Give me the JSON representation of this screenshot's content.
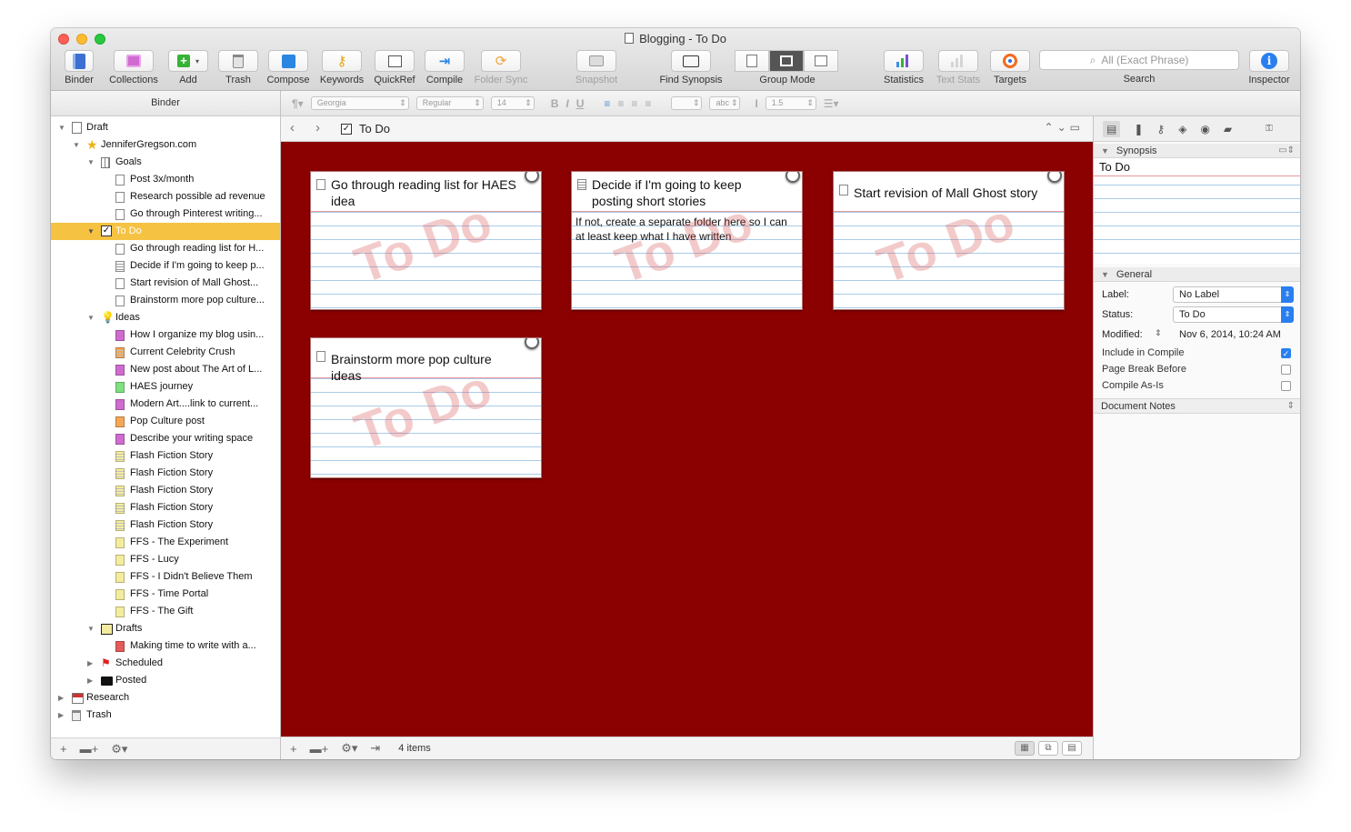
{
  "window": {
    "title": "Blogging - To Do"
  },
  "toolbar": {
    "binder": "Binder",
    "collections": "Collections",
    "add": "Add",
    "trash": "Trash",
    "compose": "Compose",
    "keywords": "Keywords",
    "quickref": "QuickRef",
    "compile": "Compile",
    "folder_sync": "Folder Sync",
    "snapshot": "Snapshot",
    "find_synopsis": "Find Synopsis",
    "group_mode": "Group Mode",
    "statistics": "Statistics",
    "text_stats": "Text Stats",
    "targets": "Targets",
    "search_placeholder": "All (Exact Phrase)",
    "search": "Search",
    "inspector": "Inspector"
  },
  "format_bar": {
    "font": "Georgia",
    "style": "Regular",
    "size": "14",
    "color_label": "abc",
    "line_spacing": "1.5"
  },
  "binder": {
    "header": "Binder",
    "items": [
      {
        "label": "Draft",
        "icon": "draft-document-icon"
      },
      {
        "label": "JenniferGregson.com",
        "icon": "star-icon"
      },
      {
        "label": "Goals",
        "icon": "grid-folder-icon"
      },
      {
        "label": "Post 3x/month",
        "icon": "page-icon"
      },
      {
        "label": "Research possible ad revenue",
        "icon": "page-icon"
      },
      {
        "label": "Go through Pinterest writing...",
        "icon": "page-icon"
      },
      {
        "label": "To Do",
        "icon": "checkbox-icon"
      },
      {
        "label": "Go through reading list for H...",
        "icon": "page-icon"
      },
      {
        "label": "Decide if I'm going to keep p...",
        "icon": "page-icon"
      },
      {
        "label": "Start revision of Mall Ghost...",
        "icon": "page-icon"
      },
      {
        "label": "Brainstorm more pop culture...",
        "icon": "page-icon"
      },
      {
        "label": "Ideas",
        "icon": "lightbulb-icon"
      },
      {
        "label": "How I organize my blog usin...",
        "icon": "page-icon"
      },
      {
        "label": "Current Celebrity Crush",
        "icon": "page-icon"
      },
      {
        "label": "New post about The Art of L...",
        "icon": "page-icon"
      },
      {
        "label": "HAES journey",
        "icon": "page-icon"
      },
      {
        "label": "Modern Art....link to current...",
        "icon": "page-icon"
      },
      {
        "label": "Pop Culture post",
        "icon": "page-icon"
      },
      {
        "label": "Describe your writing space",
        "icon": "page-icon"
      },
      {
        "label": "Flash Fiction Story",
        "icon": "page-icon"
      },
      {
        "label": "Flash Fiction Story",
        "icon": "page-icon"
      },
      {
        "label": "Flash Fiction Story",
        "icon": "page-icon"
      },
      {
        "label": "Flash Fiction Story",
        "icon": "page-icon"
      },
      {
        "label": "Flash Fiction Story",
        "icon": "page-icon"
      },
      {
        "label": "FFS - The Experiment",
        "icon": "page-icon"
      },
      {
        "label": "FFS - Lucy",
        "icon": "page-icon"
      },
      {
        "label": "FFS - I Didn't Believe Them",
        "icon": "page-icon"
      },
      {
        "label": "FFS - Time Portal",
        "icon": "page-icon"
      },
      {
        "label": "FFS - The Gift",
        "icon": "page-icon"
      },
      {
        "label": "Drafts",
        "icon": "notebook-icon"
      },
      {
        "label": "Making time to write with a...",
        "icon": "page-icon"
      },
      {
        "label": "Scheduled",
        "icon": "flag-icon"
      },
      {
        "label": "Posted",
        "icon": "monitor-icon"
      },
      {
        "label": "Research",
        "icon": "research-folder-icon"
      },
      {
        "label": "Trash",
        "icon": "trash-icon"
      }
    ]
  },
  "editor": {
    "title": "To Do",
    "item_count": "4 items",
    "cards": [
      {
        "title": "Go through reading list for HAES idea",
        "body": "",
        "stamp": "To Do"
      },
      {
        "title": "Decide if I'm going to keep posting short stories",
        "body": "If not, create a separate folder here so I can at least keep what I have written",
        "stamp": "To Do"
      },
      {
        "title": "Start revision of Mall Ghost story",
        "body": "",
        "stamp": "To Do"
      },
      {
        "title": "Brainstorm more pop culture ideas",
        "body": "",
        "stamp": "To Do"
      }
    ]
  },
  "inspector": {
    "synopsis_header": "Synopsis",
    "synopsis_text": "To Do",
    "general_header": "General",
    "label_field": "Label:",
    "label_value": "No Label",
    "status_field": "Status:",
    "status_value": "To Do",
    "modified_field": "Modified:",
    "modified_value": "Nov 6, 2014, 10:24 AM",
    "include_in_compile": "Include in Compile",
    "page_break_before": "Page Break Before",
    "compile_as_is": "Compile As-Is",
    "document_notes": "Document Notes"
  },
  "colors": {
    "corkboard": "#8b0000",
    "selection": "#f5c242",
    "accent": "#2a7ff0",
    "label_purple": "#cf6ccf",
    "label_orange": "#f3a757",
    "label_green": "#7fe07f",
    "label_yellow": "#f3ec9e",
    "label_red": "#e35b5b"
  }
}
